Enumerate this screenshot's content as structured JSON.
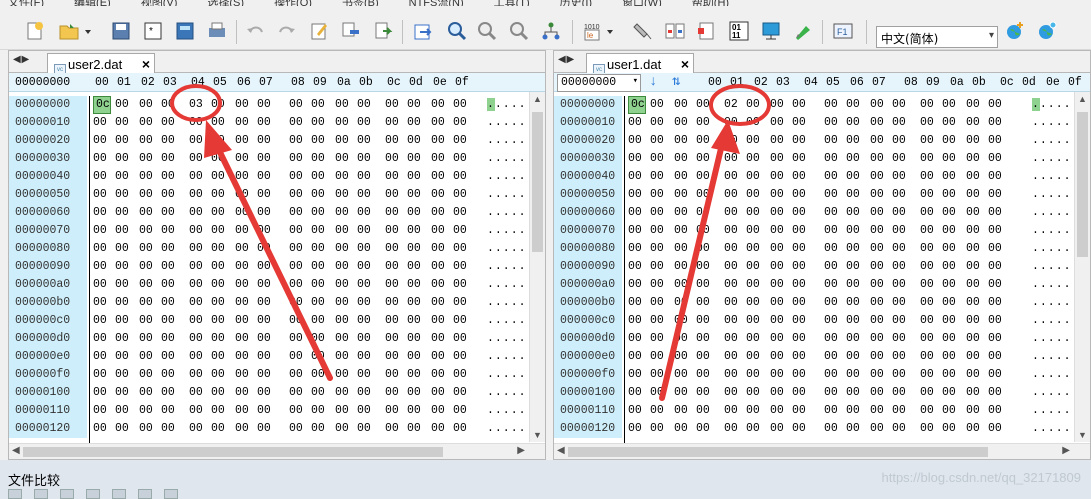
{
  "menu_items": [
    "文件(F)",
    "编辑(E)",
    "视图(V)",
    "选择(S)",
    "操作(O)",
    "书签(B)",
    "NTFS流(N)",
    "工具(T)",
    "历史(I)",
    "窗口(W)",
    "帮助(H)"
  ],
  "ime_select": "中文(简体)",
  "hex_columns": [
    "00",
    "01",
    "02",
    "03",
    "04",
    "05",
    "06",
    "07",
    "08",
    "09",
    "0a",
    "0b",
    "0c",
    "0d",
    "0e",
    "0f"
  ],
  "offsets": [
    "00000000",
    "00000010",
    "00000020",
    "00000030",
    "00000040",
    "00000050",
    "00000060",
    "00000070",
    "00000080",
    "00000090",
    "000000a0",
    "000000b0",
    "000000c0",
    "000000d0",
    "000000e0",
    "000000f0",
    "00000100",
    "00000110",
    "00000120"
  ],
  "zero_byte": "00",
  "left_pane": {
    "tab_name": "user2.dat",
    "header_offset": "00000000",
    "first_row_bytes": [
      "0c",
      "00",
      "00",
      "00",
      "03",
      "00",
      "00",
      "00",
      "00",
      "00",
      "00",
      "00",
      "00",
      "00",
      "00",
      "00"
    ],
    "first_row_ascii": ".......",
    "ascii_dots": "......"
  },
  "right_pane": {
    "tab_name": "user1.dat",
    "goto_address": "00000000",
    "first_row_bytes": [
      "0c",
      "00",
      "00",
      "00",
      "02",
      "00",
      "00",
      "00",
      "00",
      "00",
      "00",
      "00",
      "00",
      "00",
      "00",
      "00"
    ],
    "first_row_ascii": ".......",
    "ascii_dots": "......"
  },
  "status": {
    "panel_title": "文件比较",
    "watermark": "https://blog.csdn.net/qq_32171809"
  },
  "annotation_color": "#e53935",
  "selection_color": "#8fd28f",
  "offset_bg_color": "#cdeefa"
}
